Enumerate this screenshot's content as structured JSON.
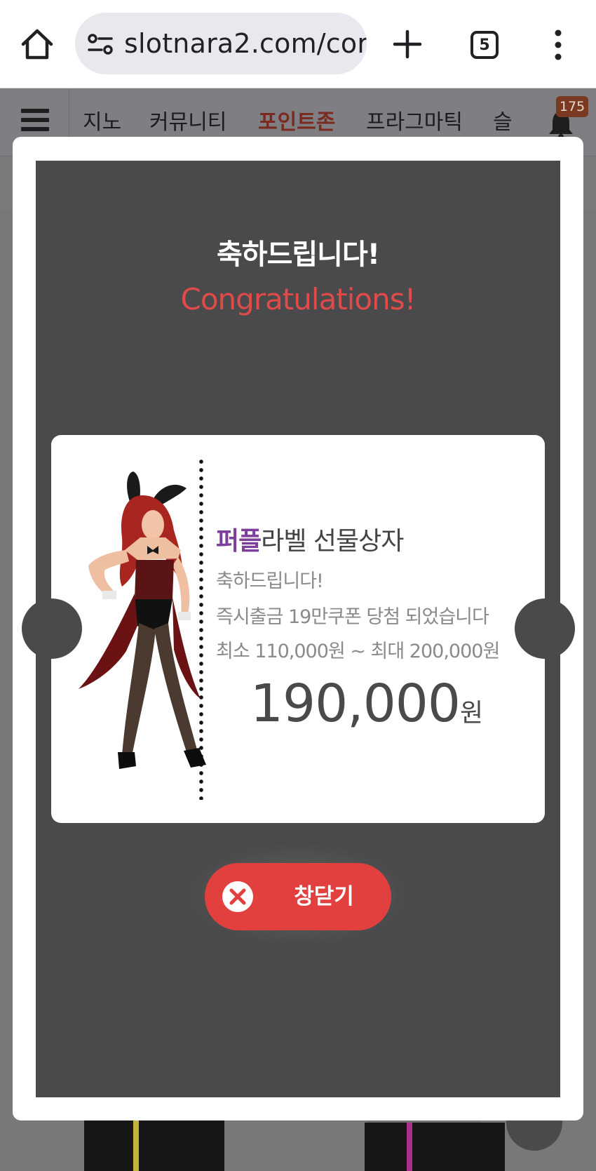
{
  "browser": {
    "url": "slotnara2.com/cor",
    "tab_count": "5",
    "icons": [
      "home-icon",
      "site-info-icon",
      "new-tab-icon",
      "tab-switcher-icon",
      "more-menu-icon"
    ]
  },
  "site_nav": {
    "items": [
      {
        "label": "지노"
      },
      {
        "label": "커뮤니티"
      },
      {
        "label": "포인트존"
      },
      {
        "label": "프라그마틱"
      },
      {
        "label": "슬"
      }
    ],
    "active_index": 2,
    "notification_count": "175"
  },
  "modal": {
    "title_ko": "축하드립니다!",
    "title_en": "Congratulations!",
    "ticket": {
      "prize_brand": "퍼플",
      "prize_rest": "라벨 선물상자",
      "line1": "축하드립니다!",
      "line2": "즉시출금 19만쿠폰 당첨 되었습니다",
      "line3": "최소 110,000원 ~ 최대 200,000원",
      "amount": "190,000",
      "unit": "원"
    },
    "close_label": "창닫기"
  },
  "colors": {
    "accent_red": "#e2403f",
    "title_red": "#e04a48",
    "brand_purple": "#7d3f9a",
    "modal_dark": "#4a494c",
    "nav_active": "#7a2a1f"
  }
}
